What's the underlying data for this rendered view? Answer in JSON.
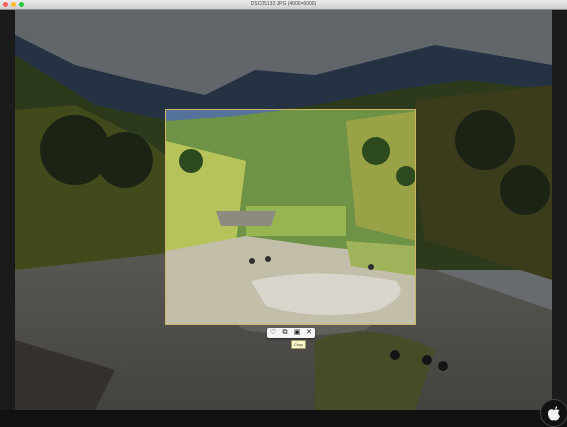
{
  "window": {
    "title": "DSC05132.JPG (4000×6000)"
  },
  "crop_toolbar": {
    "items": [
      {
        "name": "heart-icon",
        "glyph": "♡"
      },
      {
        "name": "copy-icon",
        "glyph": "⧉"
      },
      {
        "name": "crop-apply-icon",
        "glyph": "▣"
      },
      {
        "name": "close-icon",
        "glyph": "✕"
      }
    ],
    "tooltip": "Crop"
  },
  "colors": {
    "crop_border": "#c9b46a",
    "dim_overlay": "rgba(0,0,0,0.5)"
  }
}
